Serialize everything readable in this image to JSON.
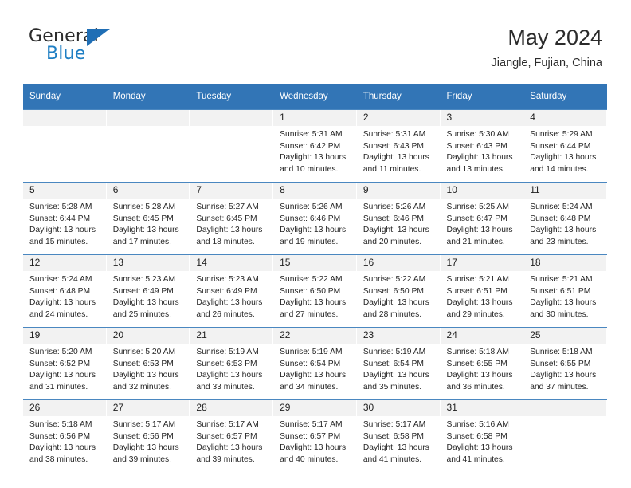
{
  "brand": {
    "name_top": "General",
    "name_bottom": "Blue"
  },
  "header": {
    "title": "May 2024",
    "subtitle": "Jiangle, Fujian, China"
  },
  "colors": {
    "header_blue": "#3275b6",
    "row_divider": "#4a87c0",
    "daynum_bg": "#f2f2f2",
    "brand_blue": "#1f7fc4"
  },
  "weekdays": [
    "Sunday",
    "Monday",
    "Tuesday",
    "Wednesday",
    "Thursday",
    "Friday",
    "Saturday"
  ],
  "labels": {
    "sunrise": "Sunrise:",
    "sunset": "Sunset:",
    "daylight": "Daylight:"
  },
  "weeks": [
    [
      {
        "day": "",
        "sunrise": "",
        "sunset": "",
        "daylight1": "",
        "daylight2": ""
      },
      {
        "day": "",
        "sunrise": "",
        "sunset": "",
        "daylight1": "",
        "daylight2": ""
      },
      {
        "day": "",
        "sunrise": "",
        "sunset": "",
        "daylight1": "",
        "daylight2": ""
      },
      {
        "day": "1",
        "sunrise": "Sunrise: 5:31 AM",
        "sunset": "Sunset: 6:42 PM",
        "daylight1": "Daylight: 13 hours",
        "daylight2": "and 10 minutes."
      },
      {
        "day": "2",
        "sunrise": "Sunrise: 5:31 AM",
        "sunset": "Sunset: 6:43 PM",
        "daylight1": "Daylight: 13 hours",
        "daylight2": "and 11 minutes."
      },
      {
        "day": "3",
        "sunrise": "Sunrise: 5:30 AM",
        "sunset": "Sunset: 6:43 PM",
        "daylight1": "Daylight: 13 hours",
        "daylight2": "and 13 minutes."
      },
      {
        "day": "4",
        "sunrise": "Sunrise: 5:29 AM",
        "sunset": "Sunset: 6:44 PM",
        "daylight1": "Daylight: 13 hours",
        "daylight2": "and 14 minutes."
      }
    ],
    [
      {
        "day": "5",
        "sunrise": "Sunrise: 5:28 AM",
        "sunset": "Sunset: 6:44 PM",
        "daylight1": "Daylight: 13 hours",
        "daylight2": "and 15 minutes."
      },
      {
        "day": "6",
        "sunrise": "Sunrise: 5:28 AM",
        "sunset": "Sunset: 6:45 PM",
        "daylight1": "Daylight: 13 hours",
        "daylight2": "and 17 minutes."
      },
      {
        "day": "7",
        "sunrise": "Sunrise: 5:27 AM",
        "sunset": "Sunset: 6:45 PM",
        "daylight1": "Daylight: 13 hours",
        "daylight2": "and 18 minutes."
      },
      {
        "day": "8",
        "sunrise": "Sunrise: 5:26 AM",
        "sunset": "Sunset: 6:46 PM",
        "daylight1": "Daylight: 13 hours",
        "daylight2": "and 19 minutes."
      },
      {
        "day": "9",
        "sunrise": "Sunrise: 5:26 AM",
        "sunset": "Sunset: 6:46 PM",
        "daylight1": "Daylight: 13 hours",
        "daylight2": "and 20 minutes."
      },
      {
        "day": "10",
        "sunrise": "Sunrise: 5:25 AM",
        "sunset": "Sunset: 6:47 PM",
        "daylight1": "Daylight: 13 hours",
        "daylight2": "and 21 minutes."
      },
      {
        "day": "11",
        "sunrise": "Sunrise: 5:24 AM",
        "sunset": "Sunset: 6:48 PM",
        "daylight1": "Daylight: 13 hours",
        "daylight2": "and 23 minutes."
      }
    ],
    [
      {
        "day": "12",
        "sunrise": "Sunrise: 5:24 AM",
        "sunset": "Sunset: 6:48 PM",
        "daylight1": "Daylight: 13 hours",
        "daylight2": "and 24 minutes."
      },
      {
        "day": "13",
        "sunrise": "Sunrise: 5:23 AM",
        "sunset": "Sunset: 6:49 PM",
        "daylight1": "Daylight: 13 hours",
        "daylight2": "and 25 minutes."
      },
      {
        "day": "14",
        "sunrise": "Sunrise: 5:23 AM",
        "sunset": "Sunset: 6:49 PM",
        "daylight1": "Daylight: 13 hours",
        "daylight2": "and 26 minutes."
      },
      {
        "day": "15",
        "sunrise": "Sunrise: 5:22 AM",
        "sunset": "Sunset: 6:50 PM",
        "daylight1": "Daylight: 13 hours",
        "daylight2": "and 27 minutes."
      },
      {
        "day": "16",
        "sunrise": "Sunrise: 5:22 AM",
        "sunset": "Sunset: 6:50 PM",
        "daylight1": "Daylight: 13 hours",
        "daylight2": "and 28 minutes."
      },
      {
        "day": "17",
        "sunrise": "Sunrise: 5:21 AM",
        "sunset": "Sunset: 6:51 PM",
        "daylight1": "Daylight: 13 hours",
        "daylight2": "and 29 minutes."
      },
      {
        "day": "18",
        "sunrise": "Sunrise: 5:21 AM",
        "sunset": "Sunset: 6:51 PM",
        "daylight1": "Daylight: 13 hours",
        "daylight2": "and 30 minutes."
      }
    ],
    [
      {
        "day": "19",
        "sunrise": "Sunrise: 5:20 AM",
        "sunset": "Sunset: 6:52 PM",
        "daylight1": "Daylight: 13 hours",
        "daylight2": "and 31 minutes."
      },
      {
        "day": "20",
        "sunrise": "Sunrise: 5:20 AM",
        "sunset": "Sunset: 6:53 PM",
        "daylight1": "Daylight: 13 hours",
        "daylight2": "and 32 minutes."
      },
      {
        "day": "21",
        "sunrise": "Sunrise: 5:19 AM",
        "sunset": "Sunset: 6:53 PM",
        "daylight1": "Daylight: 13 hours",
        "daylight2": "and 33 minutes."
      },
      {
        "day": "22",
        "sunrise": "Sunrise: 5:19 AM",
        "sunset": "Sunset: 6:54 PM",
        "daylight1": "Daylight: 13 hours",
        "daylight2": "and 34 minutes."
      },
      {
        "day": "23",
        "sunrise": "Sunrise: 5:19 AM",
        "sunset": "Sunset: 6:54 PM",
        "daylight1": "Daylight: 13 hours",
        "daylight2": "and 35 minutes."
      },
      {
        "day": "24",
        "sunrise": "Sunrise: 5:18 AM",
        "sunset": "Sunset: 6:55 PM",
        "daylight1": "Daylight: 13 hours",
        "daylight2": "and 36 minutes."
      },
      {
        "day": "25",
        "sunrise": "Sunrise: 5:18 AM",
        "sunset": "Sunset: 6:55 PM",
        "daylight1": "Daylight: 13 hours",
        "daylight2": "and 37 minutes."
      }
    ],
    [
      {
        "day": "26",
        "sunrise": "Sunrise: 5:18 AM",
        "sunset": "Sunset: 6:56 PM",
        "daylight1": "Daylight: 13 hours",
        "daylight2": "and 38 minutes."
      },
      {
        "day": "27",
        "sunrise": "Sunrise: 5:17 AM",
        "sunset": "Sunset: 6:56 PM",
        "daylight1": "Daylight: 13 hours",
        "daylight2": "and 39 minutes."
      },
      {
        "day": "28",
        "sunrise": "Sunrise: 5:17 AM",
        "sunset": "Sunset: 6:57 PM",
        "daylight1": "Daylight: 13 hours",
        "daylight2": "and 39 minutes."
      },
      {
        "day": "29",
        "sunrise": "Sunrise: 5:17 AM",
        "sunset": "Sunset: 6:57 PM",
        "daylight1": "Daylight: 13 hours",
        "daylight2": "and 40 minutes."
      },
      {
        "day": "30",
        "sunrise": "Sunrise: 5:17 AM",
        "sunset": "Sunset: 6:58 PM",
        "daylight1": "Daylight: 13 hours",
        "daylight2": "and 41 minutes."
      },
      {
        "day": "31",
        "sunrise": "Sunrise: 5:16 AM",
        "sunset": "Sunset: 6:58 PM",
        "daylight1": "Daylight: 13 hours",
        "daylight2": "and 41 minutes."
      },
      {
        "day": "",
        "sunrise": "",
        "sunset": "",
        "daylight1": "",
        "daylight2": ""
      }
    ]
  ]
}
